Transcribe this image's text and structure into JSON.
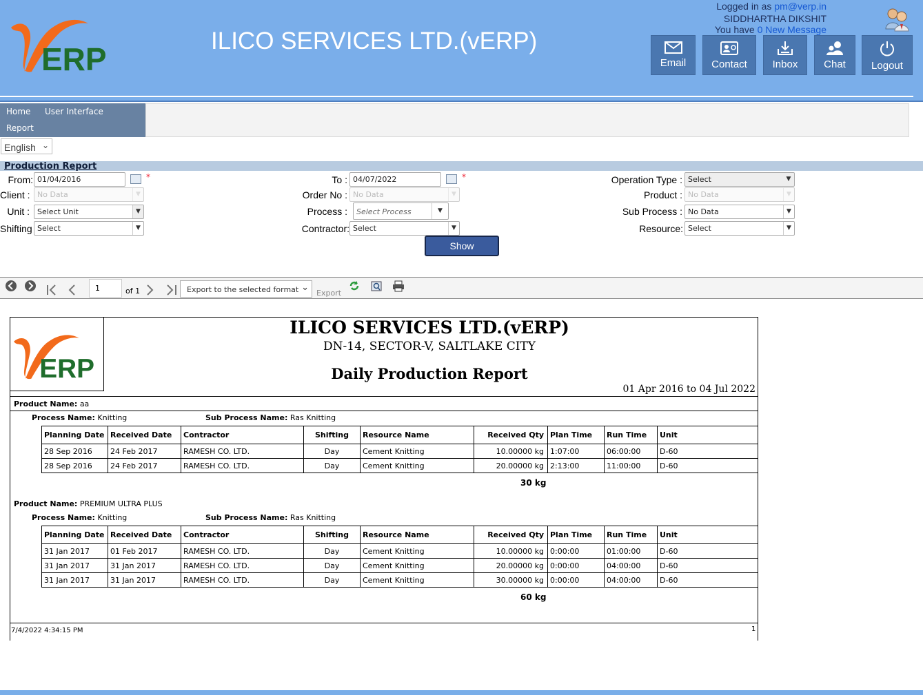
{
  "header": {
    "title": "ILICO SERVICES LTD.(vERP)",
    "logged_in_prefix": "Logged in as ",
    "user_email": "pm@verp.in",
    "user_name": "SIDDHARTHA DIKSHIT",
    "message_prefix": "You have ",
    "message_link": "0 New Message",
    "logo_text": "vERP",
    "buttons": [
      {
        "label": "Email",
        "icon": "envelope-icon"
      },
      {
        "label": "Contact",
        "icon": "contact-card-icon"
      },
      {
        "label": "Inbox",
        "icon": "inbox-download-icon"
      },
      {
        "label": "Chat",
        "icon": "chat-users-icon"
      },
      {
        "label": "Logout",
        "icon": "power-icon"
      }
    ]
  },
  "nav": {
    "items": [
      "Home",
      "User Interface",
      "Report"
    ],
    "language": "English"
  },
  "section_title": "Production Report",
  "filters": {
    "from": {
      "label": "From:",
      "value": "01/04/2016"
    },
    "to": {
      "label": "To :",
      "value": "04/07/2022"
    },
    "operation_type": {
      "label": "Operation Type :",
      "value": "Select"
    },
    "client": {
      "label": "Client :",
      "value": "No Data"
    },
    "order_no": {
      "label": "Order No :",
      "value": "No Data"
    },
    "product": {
      "label": "Product :",
      "value": "No Data"
    },
    "unit": {
      "label": "Unit :",
      "value": "Select Unit"
    },
    "process": {
      "label": "Process :",
      "value": "Select Process"
    },
    "sub_process": {
      "label": "Sub Process :",
      "value": "No Data"
    },
    "shifting": {
      "label": "Shifting :",
      "value": "Select"
    },
    "contractor": {
      "label": "Contractor:",
      "value": "Select"
    },
    "resource": {
      "label": "Resource:",
      "value": "Select"
    },
    "required_mark": "*",
    "show_label": "Show"
  },
  "toolbar": {
    "page": "1",
    "of_text": "of 1",
    "export_format": "Export to the selected format",
    "export_label": "Export"
  },
  "report": {
    "company": "ILICO SERVICES LTD.(vERP)",
    "address": "DN-14, SECTOR-V, SALTLAKE CITY",
    "title": "Daily Production Report",
    "date_range": "01 Apr 2016 to 04 Jul 2022",
    "product_name_label": "Product Name:",
    "process_name_label": "Process Name:",
    "sub_process_name_label": "Sub Process Name:",
    "columns": [
      "Planning Date",
      "Received Date",
      "Contractor",
      "Shifting",
      "Resource Name",
      "Received Qty",
      "Plan Time",
      "Run Time",
      "Unit"
    ],
    "groups": [
      {
        "product": "aa",
        "process": "Knitting",
        "sub_process": "Ras Knitting",
        "total": "30 kg",
        "rows": [
          [
            "28 Sep 2016",
            "24 Feb 2017",
            "RAMESH CO. LTD.",
            "Day",
            "Cement Knitting",
            "10.00000 kg",
            "1:07:00",
            "06:00:00",
            "D-60"
          ],
          [
            "28 Sep 2016",
            "24 Feb 2017",
            "RAMESH CO. LTD.",
            "Day",
            "Cement Knitting",
            "20.00000 kg",
            "2:13:00",
            "11:00:00",
            "D-60"
          ]
        ]
      },
      {
        "product": "PREMIUM ULTRA PLUS",
        "process": "Knitting",
        "sub_process": "Ras Knitting",
        "total": "60 kg",
        "rows": [
          [
            "31 Jan 2017",
            "01 Feb 2017",
            "RAMESH CO. LTD.",
            "Day",
            "Cement Knitting",
            "10.00000 kg",
            "0:00:00",
            "01:00:00",
            "D-60"
          ],
          [
            "31 Jan 2017",
            "31 Jan 2017",
            "RAMESH CO. LTD.",
            "Day",
            "Cement Knitting",
            "20.00000 kg",
            "0:00:00",
            "04:00:00",
            "D-60"
          ],
          [
            "31 Jan 2017",
            "31 Jan 2017",
            "RAMESH CO. LTD.",
            "Day",
            "Cement Knitting",
            "30.00000 kg",
            "0:00:00",
            "04:00:00",
            "D-60"
          ]
        ]
      }
    ],
    "footer_timestamp": "7/4/2022 4:34:15 PM",
    "footer_page": "1"
  }
}
